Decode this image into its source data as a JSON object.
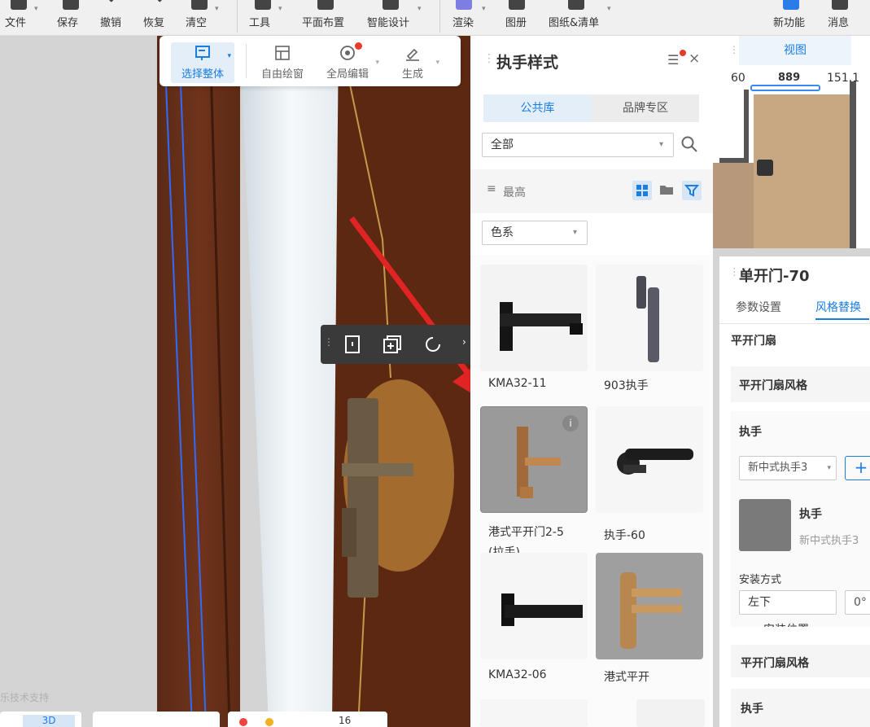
{
  "toolbar": {
    "items": [
      {
        "label": "文件",
        "icon": "file-icon"
      },
      {
        "label": "保存",
        "icon": "save-icon"
      },
      {
        "label": "撤销",
        "icon": "undo-icon"
      },
      {
        "label": "恢复",
        "icon": "redo-icon"
      },
      {
        "label": "清空",
        "icon": "eraser-icon"
      },
      {
        "label": "工具",
        "icon": "tool-icon"
      },
      {
        "label": "平面布置",
        "icon": "layout-icon"
      },
      {
        "label": "智能设计",
        "icon": "smart-icon"
      },
      {
        "label": "渲染",
        "icon": "render-icon"
      },
      {
        "label": "图册",
        "icon": "album-icon"
      },
      {
        "label": "图纸&清单",
        "icon": "drawing-icon"
      },
      {
        "label": "新功能",
        "icon": "new-feature-icon"
      },
      {
        "label": "消息",
        "icon": "bell-icon"
      }
    ]
  },
  "floatbar": {
    "select_all": "选择整体",
    "free_window": "自由绘窗",
    "global_edit": "全局编辑",
    "generate": "生成"
  },
  "viewport": {
    "watermark": "乐技术支持"
  },
  "bottom": {
    "view_mode": "3D",
    "count": "16"
  },
  "handle_panel": {
    "title": "执手样式",
    "tabs": [
      "公共库",
      "品牌专区"
    ],
    "category": "全部",
    "sort": "最高",
    "color_filter": "色系",
    "items": [
      {
        "name": "KMA32-11"
      },
      {
        "name": "903执手"
      },
      {
        "name": "港式平开门2-5",
        "name2": "(拉手)"
      },
      {
        "name": "执手-60"
      },
      {
        "name": "KMA32-06"
      },
      {
        "name": "港式平开"
      }
    ]
  },
  "view_panel": {
    "tab": "视图",
    "dim_left": "60",
    "dim_mid": "889",
    "dim_right": "151.1"
  },
  "prop_panel": {
    "title": "单开门-70",
    "tabs": [
      "参数设置",
      "风格替换"
    ],
    "section": "平开门扇",
    "style_label": "平开门扇风格",
    "handle_label": "执手",
    "handle_select": "新中式执手3",
    "handle_name": "执手",
    "handle_value": "新中式执手3",
    "install_label": "安装方式",
    "install_value": "左下",
    "angle_value": "0°",
    "position_label": "安装位置",
    "style_label2": "平开门扇风格",
    "handle_label2": "执手"
  }
}
